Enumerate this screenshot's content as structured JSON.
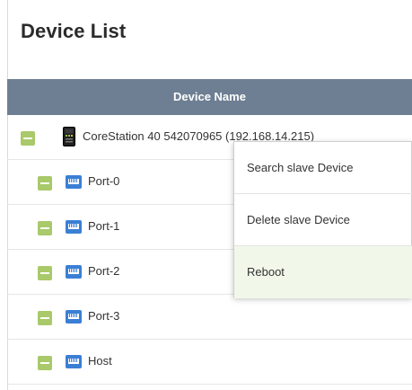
{
  "page": {
    "title": "Device List"
  },
  "table": {
    "header": "Device Name",
    "root": {
      "label": "CoreStation 40 542070965 (192.168.14.215)"
    },
    "children": [
      {
        "label": "Port-0"
      },
      {
        "label": "Port-1"
      },
      {
        "label": "Port-2"
      },
      {
        "label": "Port-3"
      },
      {
        "label": "Host"
      }
    ]
  },
  "context_menu": {
    "items": [
      {
        "label": "Search slave Device"
      },
      {
        "label": "Delete slave Device"
      },
      {
        "label": "Reboot",
        "active": true
      }
    ]
  },
  "colors": {
    "header_bg": "#6e7f93",
    "toggle": "#a9c96a",
    "port_icon": "#3a7fd5",
    "menu_active_bg": "#f1f8ea"
  },
  "icons": {
    "toggle": "minus-square-icon",
    "device": "corestation-device-icon",
    "port": "ethernet-port-icon"
  }
}
